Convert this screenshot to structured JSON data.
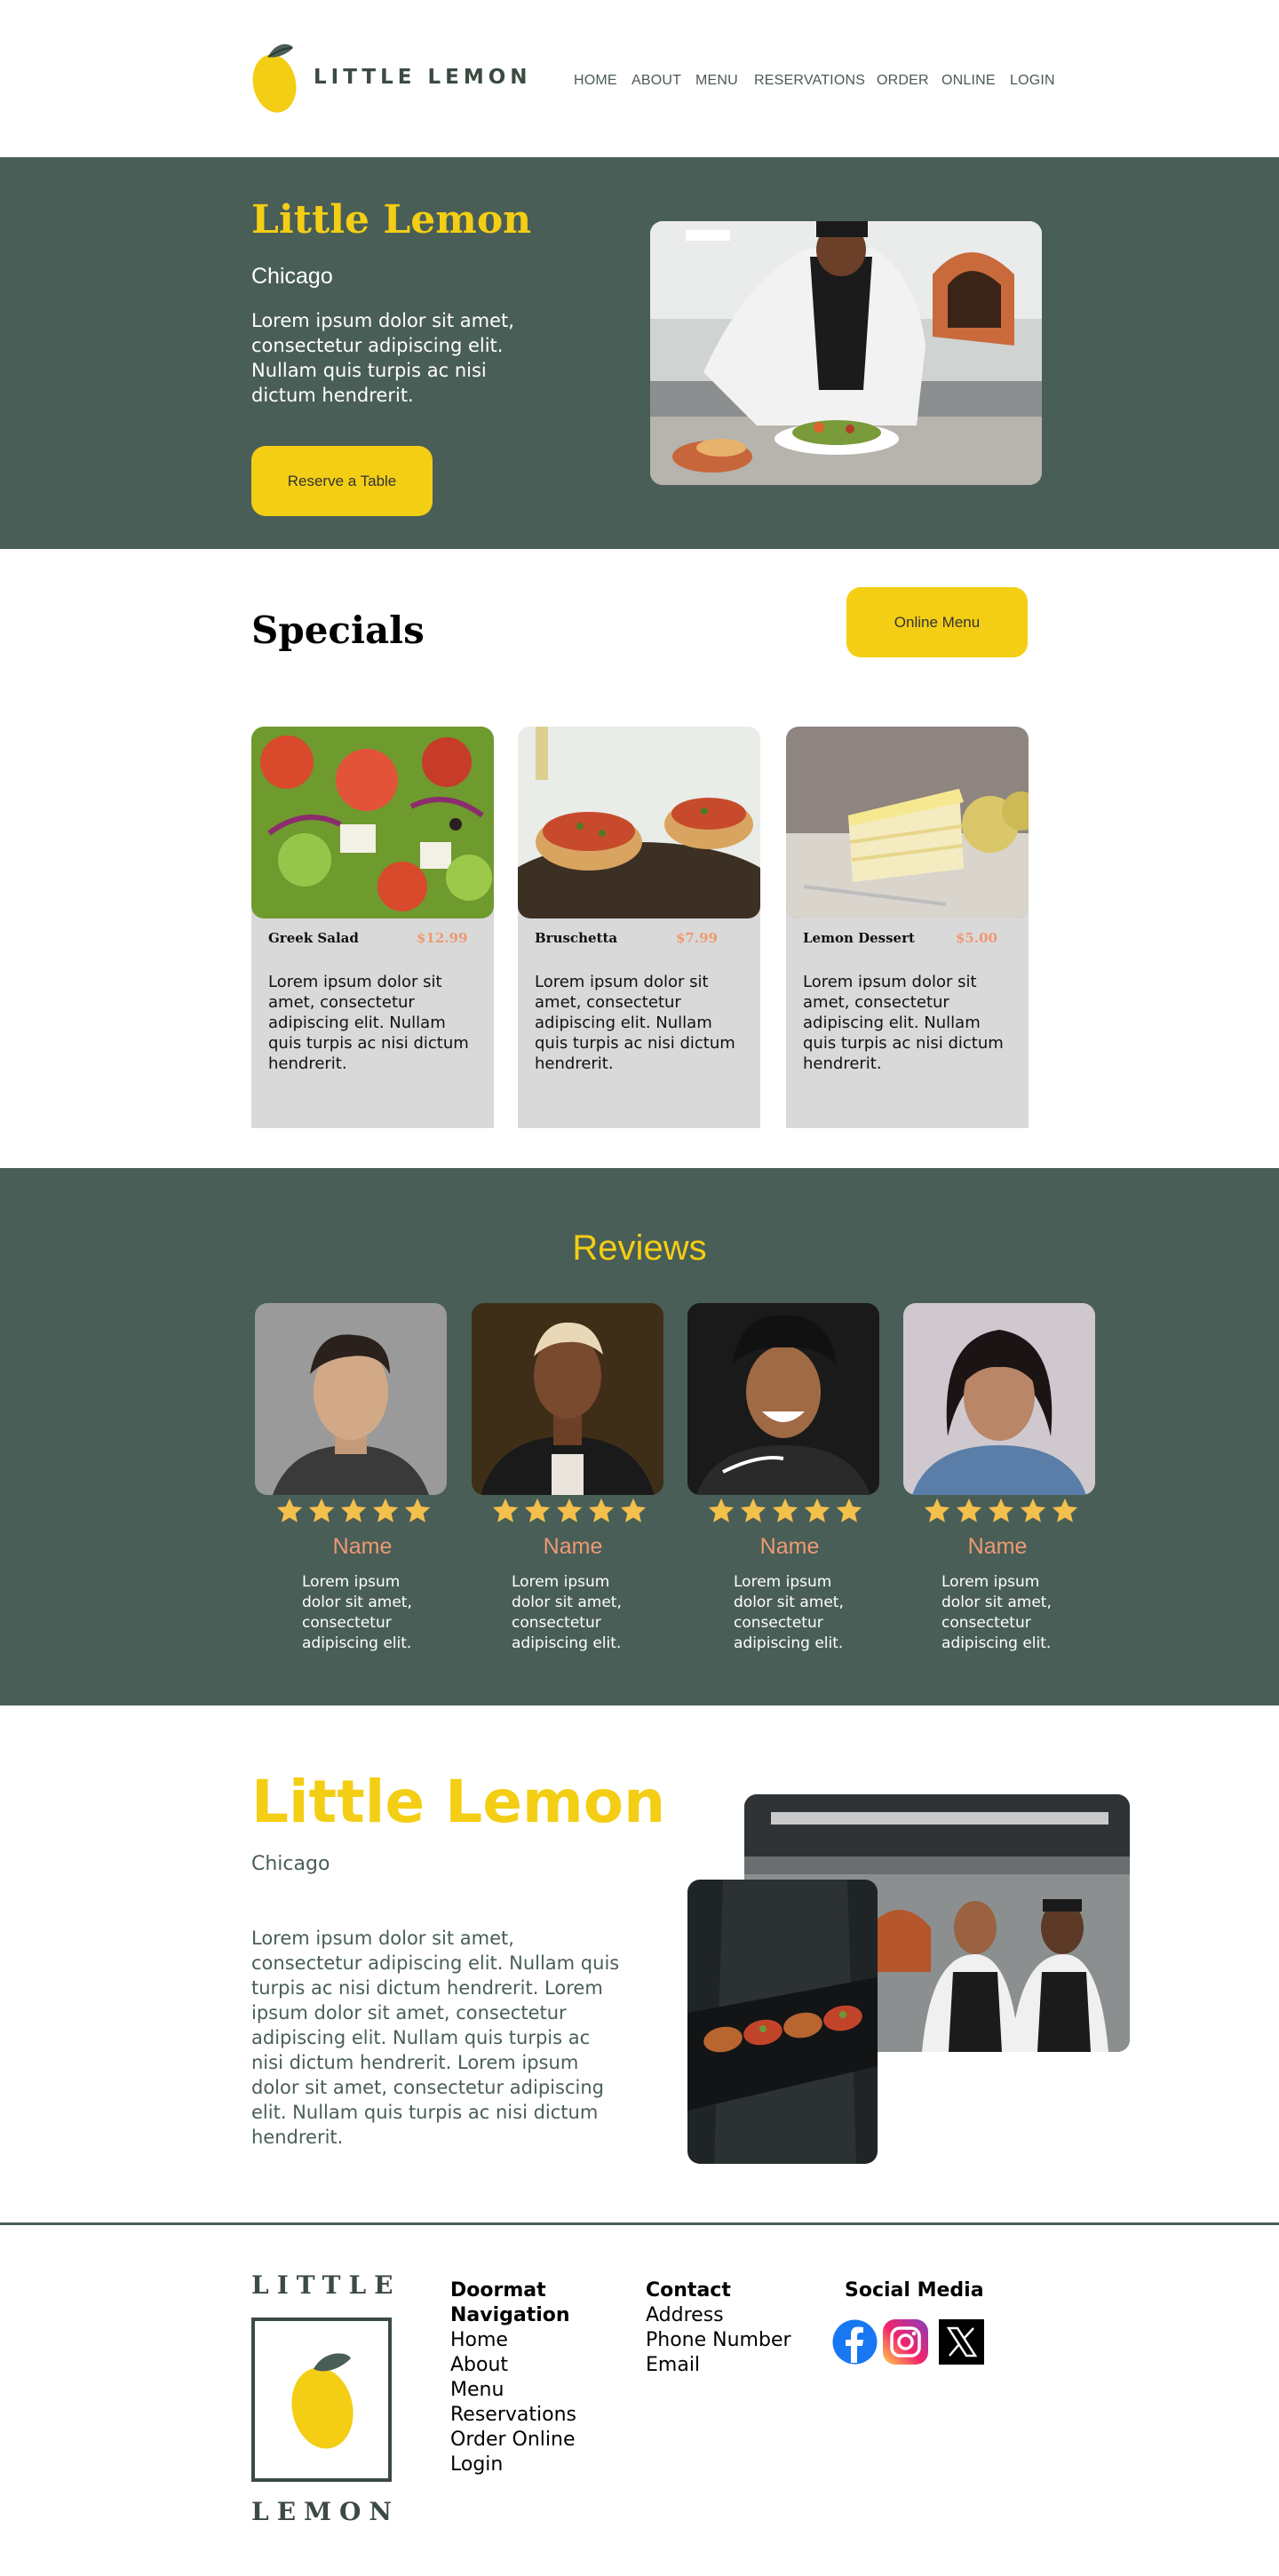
{
  "header": {
    "logo_text": "LITTLE LEMON",
    "nav": [
      "HOME",
      "ABOUT",
      "MENU",
      "RESERVATIONS",
      "ORDER",
      "ONLINE",
      "LOGIN"
    ]
  },
  "hero": {
    "title": "Little Lemon",
    "subtitle": "Chicago",
    "body": "Lorem ipsum dolor sit amet, consectetur adipiscing elit. Nullam quis turpis ac nisi dictum hendrerit.",
    "cta": "Reserve a Table"
  },
  "specials": {
    "title": "Specials",
    "menu_button": "Online Menu",
    "items": [
      {
        "name": "Greek Salad",
        "price": "$12.99",
        "desc": "Lorem ipsum dolor sit amet, consectetur adipiscing elit. Nullam quis turpis ac nisi dictum hendrerit."
      },
      {
        "name": "Bruschetta",
        "price": "$7.99",
        "desc": "Lorem ipsum dolor sit amet, consectetur adipiscing elit. Nullam quis turpis ac nisi dictum hendrerit."
      },
      {
        "name": "Lemon Dessert",
        "price": "$5.00",
        "desc": "Lorem ipsum dolor sit amet, consectetur adipiscing elit. Nullam quis turpis ac nisi dictum hendrerit."
      }
    ]
  },
  "reviews": {
    "title": "Reviews",
    "items": [
      {
        "name": "Name",
        "rating": 5,
        "text": "Lorem ipsum dolor sit amet, consectetur adipiscing elit."
      },
      {
        "name": "Name",
        "rating": 5,
        "text": "Lorem ipsum dolor sit amet, consectetur adipiscing elit."
      },
      {
        "name": "Name",
        "rating": 5,
        "text": "Lorem ipsum dolor sit amet, consectetur adipiscing elit."
      },
      {
        "name": "Name",
        "rating": 5,
        "text": "Lorem ipsum dolor sit amet, consectetur adipiscing elit."
      }
    ]
  },
  "about": {
    "title": "Little Lemon",
    "subtitle": "Chicago",
    "body": "Lorem ipsum dolor sit amet, consectetur adipiscing elit. Nullam quis turpis ac nisi dictum hendrerit. Lorem ipsum dolor sit amet, consectetur adipiscing elit. Nullam quis turpis ac nisi dictum hendrerit. Lorem ipsum dolor sit amet, consectetur adipiscing elit. Nullam quis turpis ac nisi dictum hendrerit."
  },
  "footer": {
    "logo_top": "LITTLE",
    "logo_bottom": "LEMON",
    "doormat": {
      "heading_line1": "Doormat",
      "heading_line2": "Navigation",
      "links": [
        "Home",
        "About",
        "Menu",
        "Reservations",
        "Order Online",
        "Login"
      ]
    },
    "contact": {
      "heading": "Contact",
      "lines": [
        "Address",
        "Phone Number",
        "Email"
      ]
    },
    "social": {
      "heading": "Social Media",
      "icons": [
        "facebook-icon",
        "instagram-icon",
        "x-icon"
      ]
    }
  },
  "colors": {
    "primary_green": "#495e57",
    "primary_yellow": "#f4ce14",
    "accent_salmon": "#ee9972",
    "card_gray": "#d9d9d9"
  }
}
